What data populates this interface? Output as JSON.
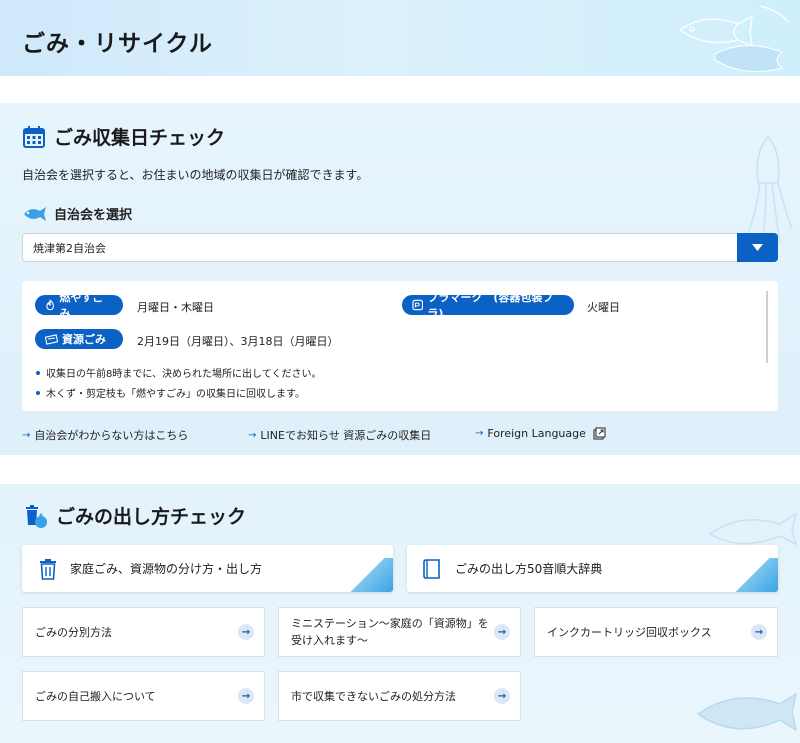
{
  "header": {
    "title": "ごみ・リサイクル"
  },
  "collection_check": {
    "title": "ごみ収集日チェック",
    "intro": "自治会を選択すると、お住まいの地域の収集日が確認できます。",
    "select_label": "自治会を選択",
    "selected_value": "焼津第2自治会",
    "schedule": [
      {
        "category": "燃やすごみ",
        "icon": "flame-icon",
        "days": "月曜日・木曜日"
      },
      {
        "category": "プラマーク　(容器包装プラ)",
        "icon": "plastic-mark-icon",
        "days": "火曜日"
      },
      {
        "category": "資源ごみ",
        "icon": "recycle-bundle-icon",
        "days": "2月19日（月曜日）、3月18日（月曜日）"
      }
    ],
    "notes": [
      "収集日の午前8時までに、決められた場所に出してください。",
      "木くず・剪定枝も「燃やすごみ」の収集日に回収します。"
    ],
    "links": [
      {
        "label": "自治会がわからない方はこちら"
      },
      {
        "label": "LINEでお知らせ 資源ごみの収集日"
      },
      {
        "label": "Foreign Language",
        "icon": "external-link-icon"
      }
    ]
  },
  "disposal_check": {
    "title": "ごみの出し方チェック",
    "feature_cards": [
      {
        "label": "家庭ごみ、資源物の分け方・出し方",
        "icon": "trash-can-icon"
      },
      {
        "label": "ごみの出し方50音順大辞典",
        "icon": "book-icon"
      }
    ],
    "link_cards": [
      {
        "label": "ごみの分別方法"
      },
      {
        "label_line1": "ミニステーション〜家庭の「資源物」を",
        "label_line2": "受け入れます〜"
      },
      {
        "label": "インクカートリッジ回収ボックス"
      },
      {
        "label": "ごみの自己搬入について"
      },
      {
        "label": "市で収集できないごみの処分方法"
      }
    ]
  },
  "colors": {
    "accent": "#0b62c4",
    "header_bg": "#d6edfb",
    "section_bg": "#e3f2fb"
  }
}
